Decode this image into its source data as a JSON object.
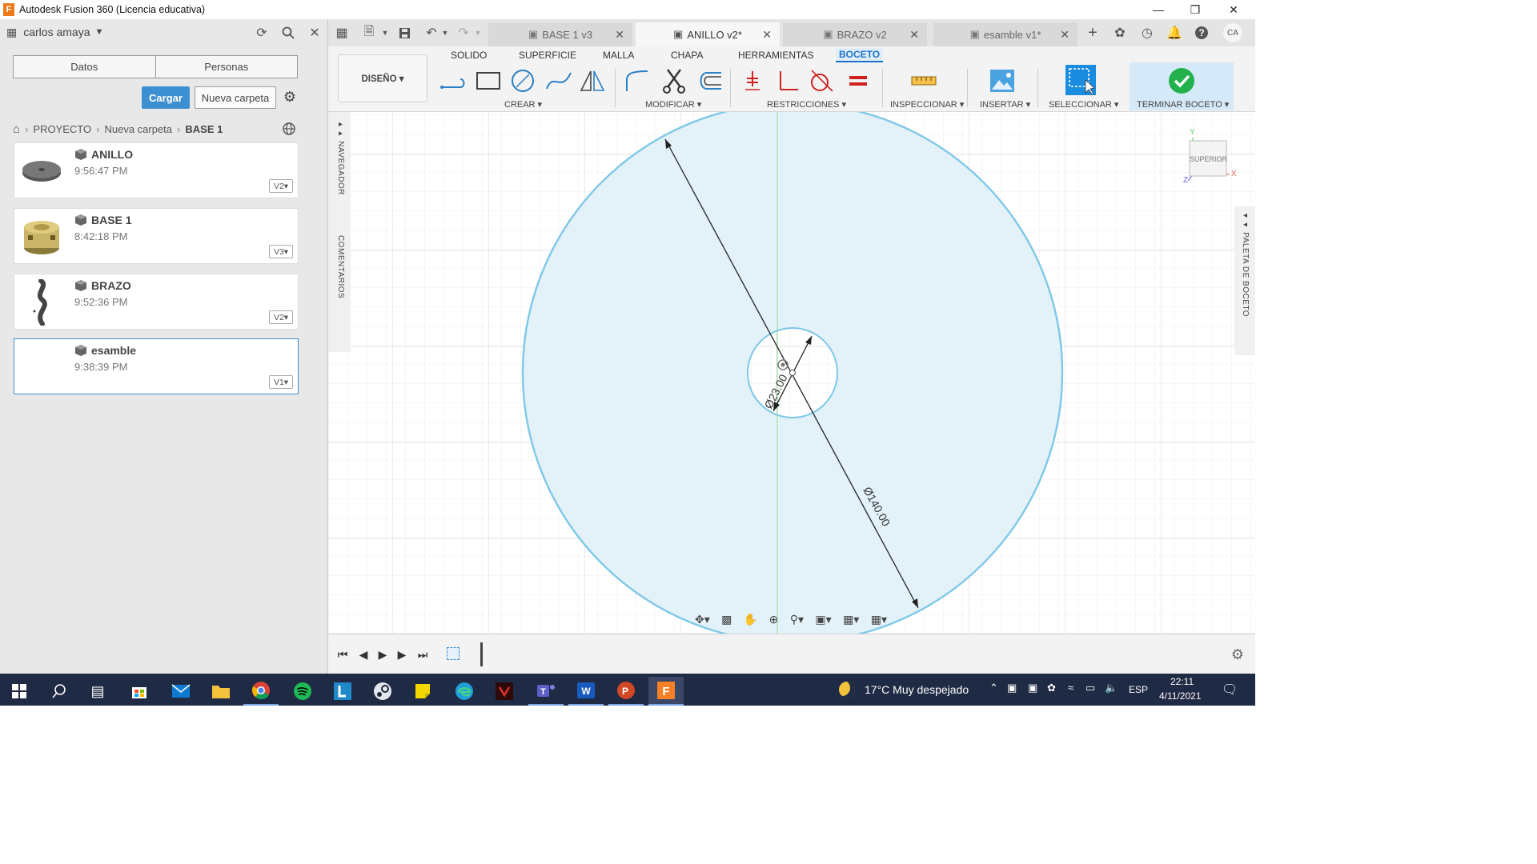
{
  "window": {
    "app_icon_letter": "F",
    "title": "Autodesk Fusion 360 (Licencia educativa)"
  },
  "data_panel": {
    "user": "carlos amaya",
    "tabs": [
      "Datos",
      "Personas"
    ],
    "upload_label": "Cargar",
    "new_folder_label": "Nueva carpeta",
    "breadcrumb": [
      "PROYECTO",
      "Nueva carpeta",
      "BASE 1"
    ],
    "files": [
      {
        "name": "ANILLO",
        "time": "9:56:47 PM",
        "version": "V2▾"
      },
      {
        "name": "BASE 1",
        "time": "8:42:18 PM",
        "version": "V3▾"
      },
      {
        "name": "BRAZO",
        "time": "9:52:36 PM",
        "version": "V2▾"
      },
      {
        "name": "esamble",
        "time": "9:38:39 PM",
        "version": "V1▾"
      }
    ]
  },
  "doc_tabs": [
    {
      "label": "BASE 1 v3",
      "active": false
    },
    {
      "label": "ANILLO v2*",
      "active": true
    },
    {
      "label": "BRAZO v2",
      "active": false
    },
    {
      "label": "esamble v1*",
      "active": false
    }
  ],
  "toolbar": {
    "workspace": "DISEÑO ▾",
    "ribbon_tabs": [
      "SOLIDO",
      "SUPERFICIE",
      "MALLA",
      "CHAPA",
      "HERRAMIENTAS",
      "BOCETO"
    ],
    "active_tab": "BOCETO",
    "groups": {
      "create": "CREAR ▾",
      "modify": "MODIFICAR ▾",
      "constraints": "RESTRICCIONES ▾",
      "inspect": "INSPECCIONAR ▾",
      "insert": "INSERTAR ▾",
      "select": "SELECCIONAR ▾",
      "finish": "TERMINAR BOCETO ▾"
    }
  },
  "canvas": {
    "browser_label": "NAVEGADOR",
    "comments_label": "COMENTARIOS",
    "palette_label": "PALETA DE BOCETO",
    "viewcube_label": "SUPERIOR",
    "axis_labels": {
      "x": "X",
      "y": "Y",
      "z": "Z"
    },
    "dim_outer": "Ø140.00",
    "dim_inner": "Ø23.00",
    "sketch_color": "#7ec8e8",
    "fill_color": "#e3f1f9"
  },
  "taskbar": {
    "weather": "17°C  Muy despejado",
    "language": "ESP",
    "time": "22:11",
    "date": "4/11/2021"
  },
  "colors": {
    "accent": "#3c8fd0",
    "active_tab": "#1a73c8",
    "taskbar": "#1f2a44"
  }
}
